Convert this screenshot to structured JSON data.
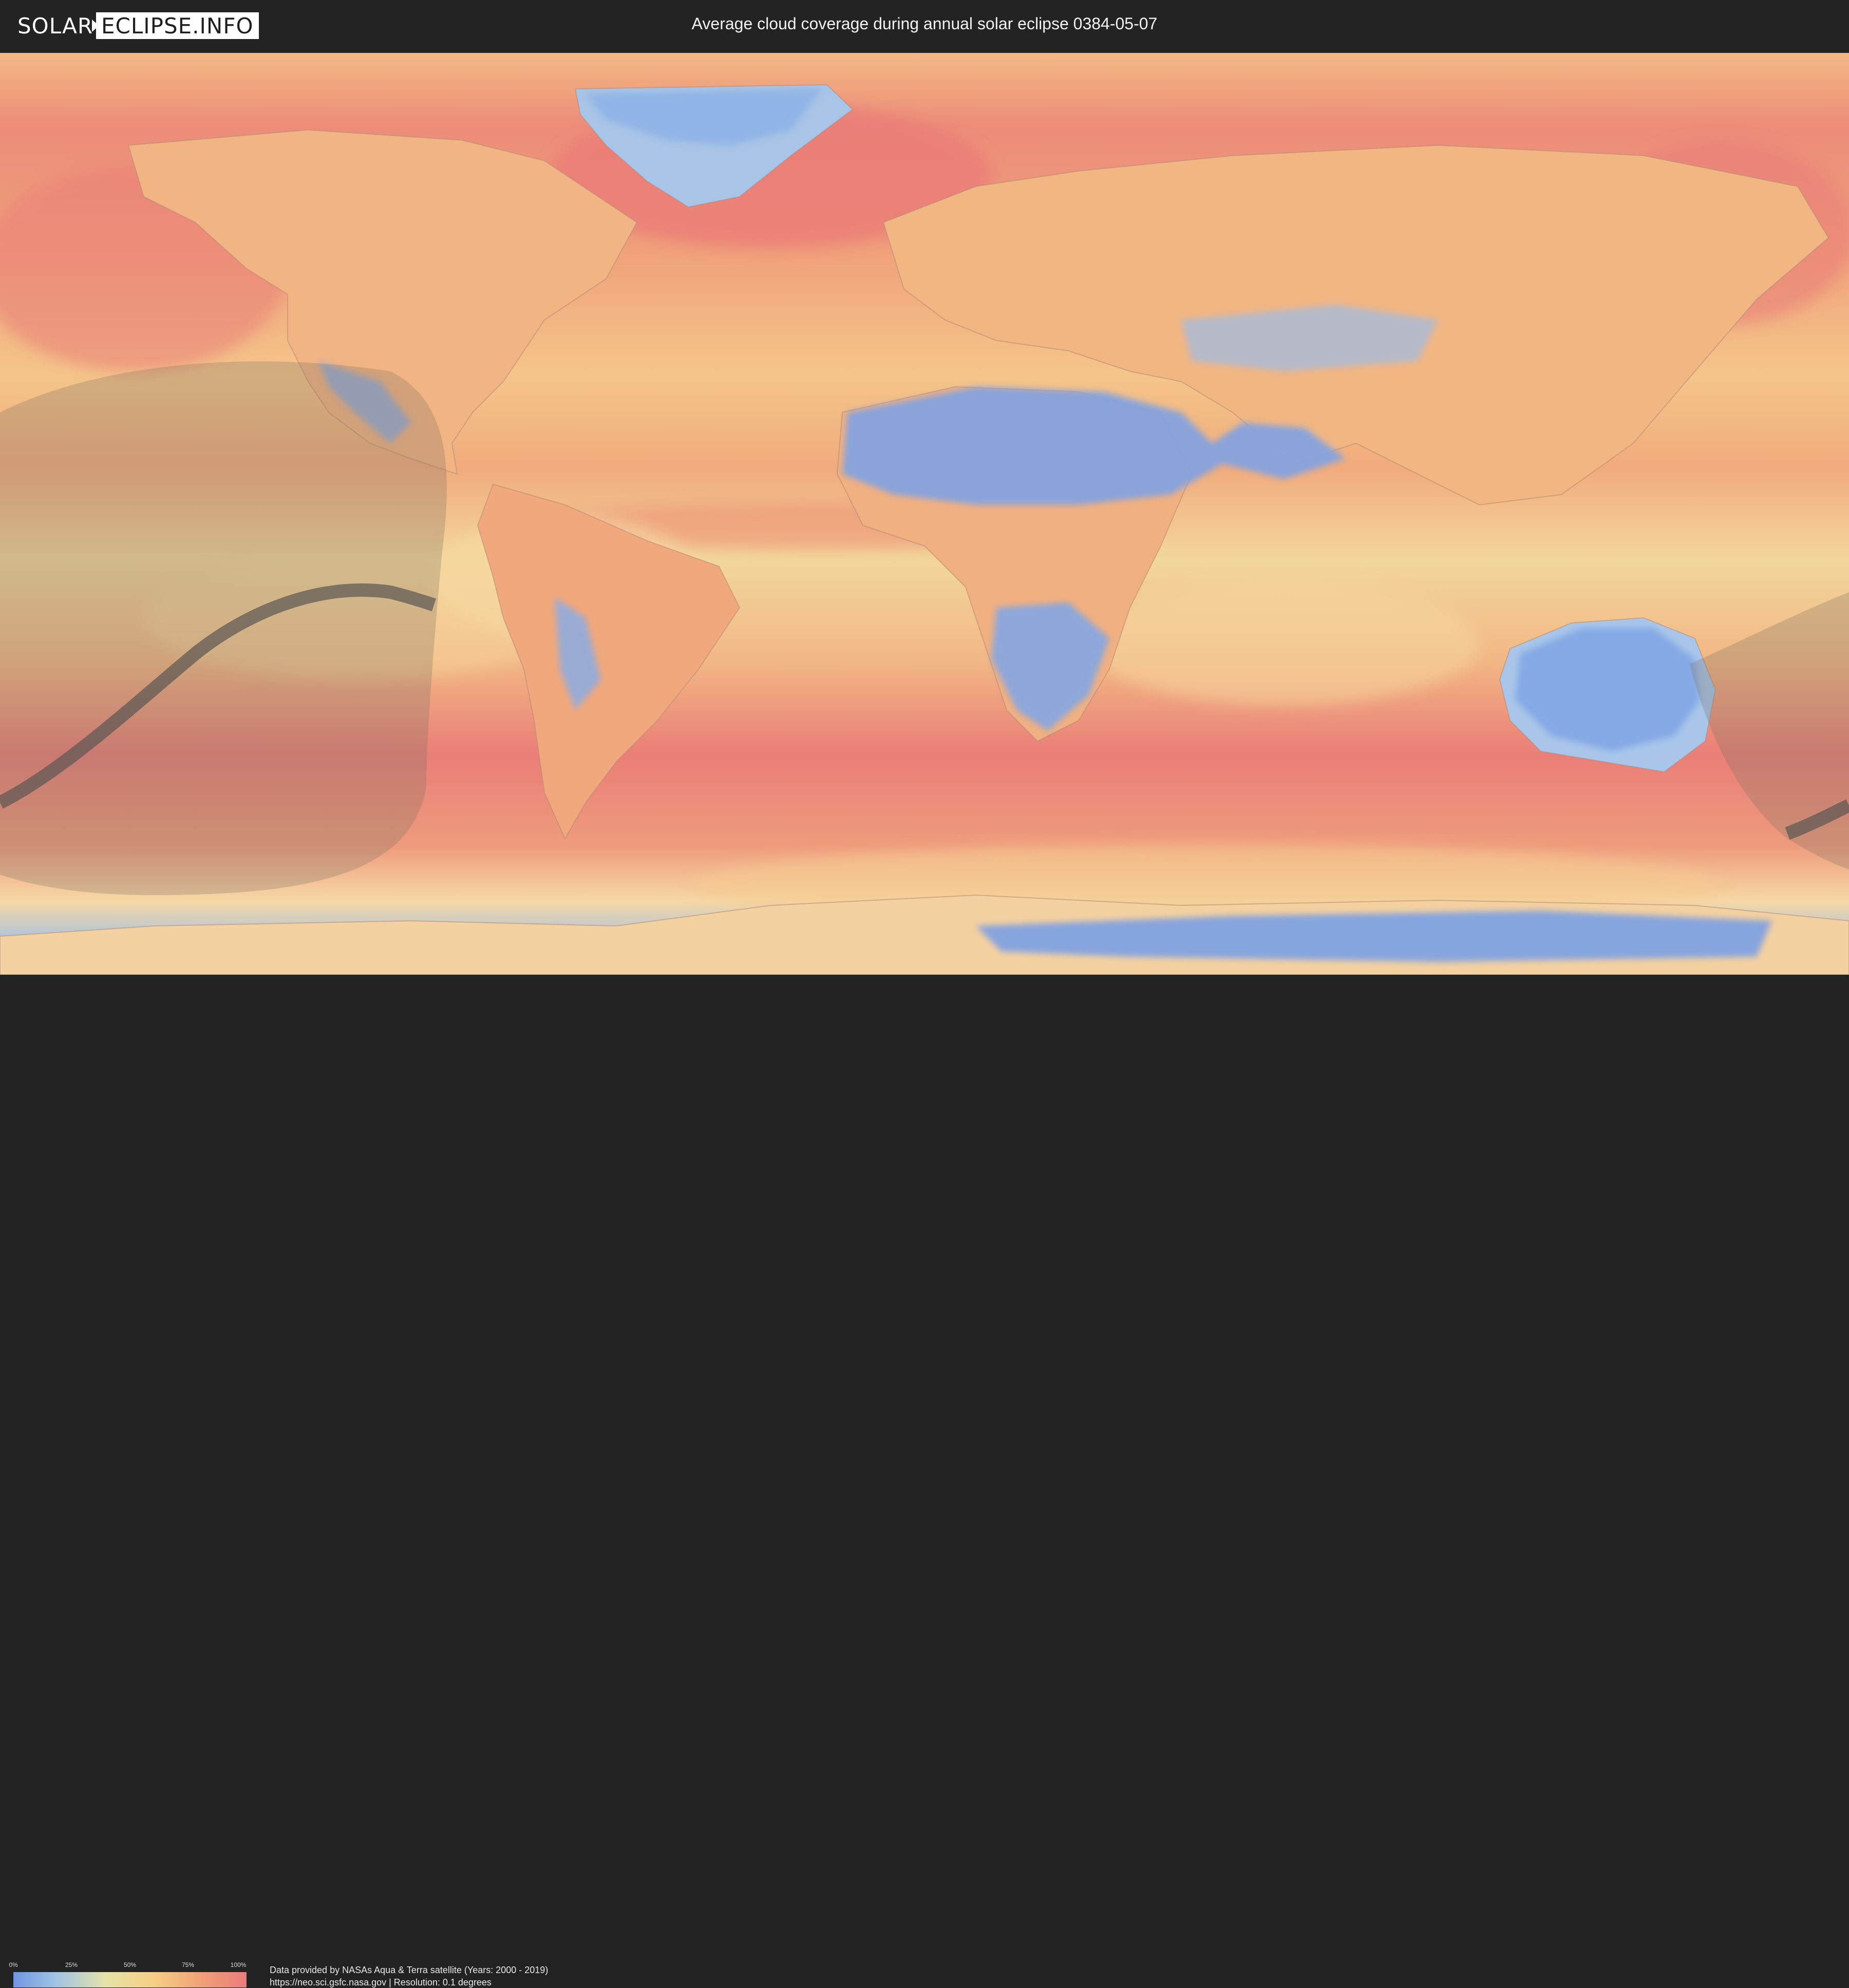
{
  "header": {
    "logo_left": "SOLAR",
    "logo_right": "ECLIPSE.INFO",
    "title": "Average cloud coverage during annual solar eclipse 0384-05-07"
  },
  "map": {
    "icon": "world-cloud-coverage-map",
    "layers": [
      "average cloud coverage",
      "eclipse visibility zones",
      "central path of annularity"
    ]
  },
  "legend": {
    "ticks": [
      "0%",
      "25%",
      "50%",
      "75%",
      "100%"
    ],
    "colors": [
      "#6f97e2",
      "#e6e3a6",
      "#f7cf85",
      "#f1a277",
      "#ea7b7b"
    ]
  },
  "footer": {
    "credit_line1": "Data provided by NASAs Aqua & Terra satellite (Years: 2000 - 2019)",
    "credit_line2": "https://neo.sci.gsfc.nasa.gov | Resolution: 0.1 degrees"
  },
  "colors": {
    "background": "#232323",
    "clear": "#6f97e2",
    "cloudy": "#ea7b7b",
    "path": "#5a5652"
  }
}
